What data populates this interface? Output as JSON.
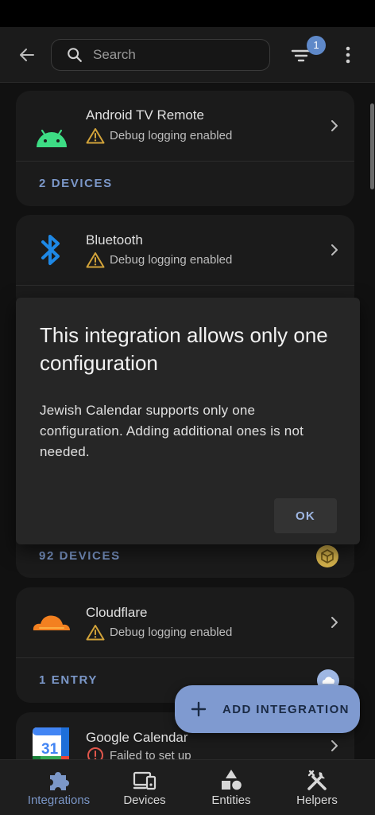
{
  "header": {
    "search_placeholder": "Search",
    "filter_count": "1"
  },
  "cards": [
    {
      "title": "Android TV Remote",
      "status": "Debug logging enabled",
      "footer": "2 DEVICES",
      "logo": "android-logo"
    },
    {
      "title": "Bluetooth",
      "status": "Debug logging enabled",
      "footer": "",
      "logo": "bluetooth-logo"
    },
    {
      "title": "",
      "status": "",
      "footer": "92 DEVICES",
      "logo": ""
    },
    {
      "title": "Cloudflare",
      "status": "Debug logging enabled",
      "footer": "1 ENTRY",
      "logo": "cloudflare-logo"
    },
    {
      "title": "Google Calendar",
      "status": "Failed to set up",
      "footer": "",
      "logo": "google-calendar-logo",
      "logo_text": "31"
    }
  ],
  "dialog": {
    "title": "This integration allows only one configuration",
    "body": "Jewish Calendar supports only one configuration. Adding additional ones is not needed.",
    "ok_label": "OK"
  },
  "fab": {
    "label": "ADD INTEGRATION"
  },
  "bottom_nav": [
    {
      "label": "Integrations",
      "icon": "puzzle-icon",
      "active": true
    },
    {
      "label": "Devices",
      "icon": "devices-icon",
      "active": false
    },
    {
      "label": "Entities",
      "icon": "shapes-icon",
      "active": false
    },
    {
      "label": "Helpers",
      "icon": "tools-icon",
      "active": false
    }
  ],
  "colors": {
    "accent": "#7b97c8",
    "fab": "#7f9ad0",
    "warning": "#d2a33a",
    "error": "#e2574c",
    "background": "#111111",
    "card": "#1b1b1b",
    "dialog": "#262626"
  }
}
